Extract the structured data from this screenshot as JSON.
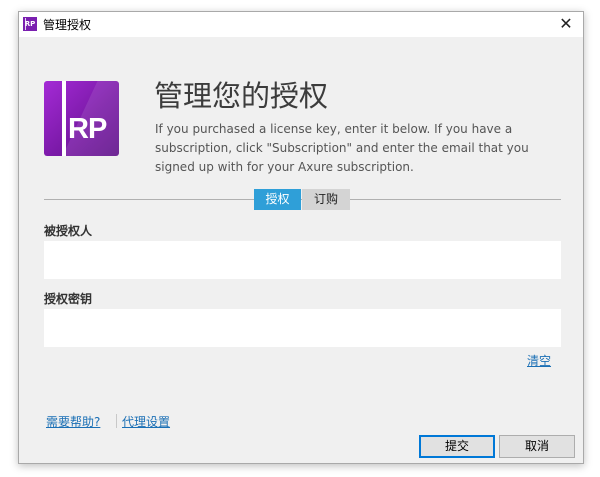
{
  "window": {
    "title": "管理授权",
    "close_glyph": "✕",
    "app_icon": "RP"
  },
  "logo": {
    "text": "RP"
  },
  "header": {
    "title": "管理您的授权",
    "description": "If you purchased a license key, enter it below. If you have a subscription, click \"Subscription\" and enter the email that you signed up with for your Axure subscription."
  },
  "tabs": [
    {
      "label": "授权",
      "active": true
    },
    {
      "label": "订购",
      "active": false
    }
  ],
  "fields": {
    "licensee_label": "被授权人",
    "licensee_value": "",
    "key_label": "授权密钥",
    "key_value": ""
  },
  "links": {
    "clear": "清空",
    "help": "需要帮助?",
    "proxy": "代理设置"
  },
  "buttons": {
    "submit": "提交",
    "cancel": "取消"
  },
  "colors": {
    "accent": "#2f9fd8",
    "brand": "#8e24c2",
    "link": "#1a6fb5"
  }
}
